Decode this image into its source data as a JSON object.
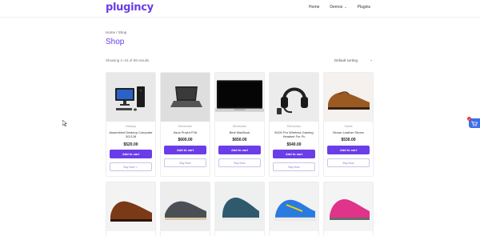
{
  "brand": {
    "logo": "plugincy"
  },
  "nav": {
    "home": "Home",
    "demos": "Demos",
    "plugins": "Plugins"
  },
  "breadcrumb": "Home / Shop",
  "page_title": "Shop",
  "result_count": "Showing 1–15 of 89 results",
  "sort": {
    "label": "Default sorting"
  },
  "products": [
    {
      "category": "Desktop",
      "name": "Assembled Desktop Computer 3/2/128",
      "price": "$520.00",
      "add": "Add to cart",
      "buy": "Buy Now ✓"
    },
    {
      "category": "Electronics",
      "name": "Asus ProArt P16",
      "price": "$600.00",
      "add": "Add to cart",
      "buy": "Buy Now"
    },
    {
      "category": "Electronics",
      "name": "Best MacBook",
      "price": "$650.00",
      "add": "Add to cart",
      "buy": "Buy Now"
    },
    {
      "category": "Electronics",
      "name": "B100 Pro Wireless Gaming Headset For Pc",
      "price": "$540.00",
      "add": "Add to cart",
      "buy": "Buy Now"
    },
    {
      "category": "Shoes",
      "name": "Brown Leather Shoes",
      "price": "$530.00",
      "add": "Add to cart",
      "buy": "Buy Now"
    }
  ],
  "cart": {
    "count": "1"
  },
  "colors": {
    "accent": "#6a3de8",
    "cart": "#3d6fe8",
    "badge": "#e03a3a"
  }
}
